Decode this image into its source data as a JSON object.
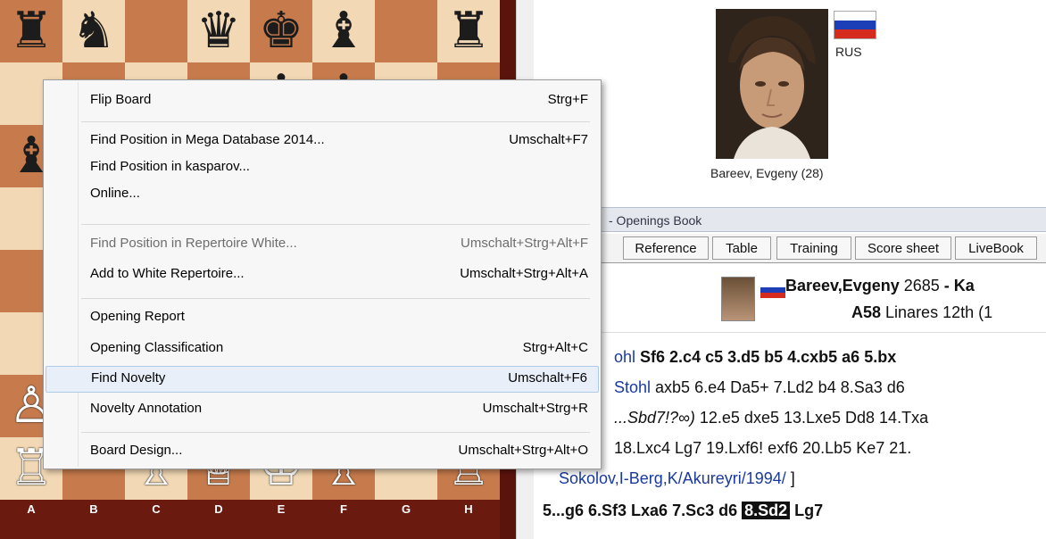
{
  "board": {
    "files": [
      "A",
      "B",
      "C",
      "D",
      "E",
      "F",
      "G",
      "H"
    ],
    "pieces": [
      {
        "square": "a8",
        "glyph": "♜",
        "color": "b",
        "name": "black-rook-icon"
      },
      {
        "square": "b8",
        "glyph": "♞",
        "color": "b",
        "name": "black-knight-icon"
      },
      {
        "square": "d8",
        "glyph": "♛",
        "color": "b",
        "name": "black-queen-icon"
      },
      {
        "square": "e8",
        "glyph": "♚",
        "color": "b",
        "name": "black-king-icon"
      },
      {
        "square": "f8",
        "glyph": "♝",
        "color": "b",
        "name": "black-bishop-icon"
      },
      {
        "square": "h8",
        "glyph": "♜",
        "color": "b",
        "name": "black-rook-icon"
      },
      {
        "square": "e7",
        "glyph": "♟",
        "color": "b",
        "name": "black-pawn-icon"
      },
      {
        "square": "f7",
        "glyph": "♟",
        "color": "b",
        "name": "black-pawn-icon"
      },
      {
        "square": "a6",
        "glyph": "♝",
        "color": "b",
        "name": "black-bishop-icon"
      },
      {
        "square": "a2",
        "glyph": "♙",
        "color": "w",
        "name": "white-pawn-icon"
      },
      {
        "square": "a1",
        "glyph": "♖",
        "color": "w",
        "name": "white-rook-icon"
      },
      {
        "square": "c1",
        "glyph": "♗",
        "color": "w",
        "name": "white-bishop-icon"
      },
      {
        "square": "d1",
        "glyph": "♕",
        "color": "w",
        "name": "white-queen-icon"
      },
      {
        "square": "e1",
        "glyph": "♔",
        "color": "w",
        "name": "white-king-icon"
      },
      {
        "square": "f1",
        "glyph": "♗",
        "color": "w",
        "name": "white-bishop-icon"
      },
      {
        "square": "h1",
        "glyph": "♖",
        "color": "w",
        "name": "white-rook-icon"
      }
    ]
  },
  "player": {
    "country": "RUS",
    "caption": "Bareev, Evgeny  (28)"
  },
  "book": {
    "header": "- Openings Book",
    "tabs": [
      "Reference",
      "Table",
      "Training",
      "Score sheet",
      "LiveBook"
    ]
  },
  "game": {
    "white_name": "Bareev,Evgeny",
    "white_elo": " 2685",
    "separator": " - Ka",
    "eco": "A58",
    "event": " Linares 12th (1"
  },
  "notation": {
    "line1": [
      {
        "t": "ohl ",
        "style": "blue"
      },
      {
        "t": "Sf6 2.c4 c5 3.d5 b5 4.cxb5 a6 5.bx",
        "style": "bold"
      }
    ],
    "line2": [
      {
        "t": "Stohl",
        "style": "blue"
      },
      {
        "t": " axb5 6.e4 Da5+ 7.Ld2 b4 8.Sa3 d6",
        "style": "plain"
      }
    ],
    "line3": [
      {
        "t": "...Sbd7!?∞)",
        "style": "italic"
      },
      {
        "t": " 12.e5 dxe5 13.Lxe5 Dd8 14.Txa",
        "style": "plain"
      }
    ],
    "line4": [
      {
        "t": " 18.Lxc4 Lg7 19.Lxf6! exf6 20.Lb5 Ke7 21.",
        "style": "plain"
      }
    ],
    "line5": [
      {
        "t": "Sokolov,I-Berg,K/Akureyri/1994/",
        "style": "blue"
      },
      {
        "t": " ]",
        "style": "plain"
      }
    ],
    "line6_before": "5...g6 6.Sf3 Lxa6 7.Sc3 d6 ",
    "line6_highlight": "8.Sd2",
    "line6_after": " Lg7"
  },
  "context_menu": {
    "items": [
      {
        "label": "Flip Board",
        "shortcut": "Strg+F",
        "disabled": false,
        "hover": false
      },
      {
        "label": "Find Position in Mega Database 2014...",
        "shortcut": "Umschalt+F7",
        "disabled": false,
        "hover": false
      },
      {
        "label": "Find Position in kasparov...",
        "shortcut": "",
        "disabled": false,
        "hover": false
      },
      {
        "label": "Online...",
        "shortcut": "",
        "disabled": false,
        "hover": false
      },
      {
        "label": "Find Position in Repertoire White...",
        "shortcut": "Umschalt+Strg+Alt+F",
        "disabled": true,
        "hover": false
      },
      {
        "label": "Add to White Repertoire...",
        "shortcut": "Umschalt+Strg+Alt+A",
        "disabled": false,
        "hover": false
      },
      {
        "label": "Opening Report",
        "shortcut": "",
        "disabled": false,
        "hover": false
      },
      {
        "label": "Opening Classification",
        "shortcut": "Strg+Alt+C",
        "disabled": false,
        "hover": false
      },
      {
        "label": "Find Novelty",
        "shortcut": "Umschalt+F6",
        "disabled": false,
        "hover": true
      },
      {
        "label": "Novelty Annotation",
        "shortcut": "Umschalt+Strg+R",
        "disabled": false,
        "hover": false
      },
      {
        "label": "Board Design...",
        "shortcut": "Umschalt+Strg+Alt+O",
        "disabled": false,
        "hover": false
      }
    ]
  },
  "colors": {
    "board_light": "#f2d8b4",
    "board_dark": "#c77b4c",
    "board_border": "#6b1a10",
    "menu_hover": "#e8eff8",
    "notation_blue": "#1a3aa0"
  }
}
